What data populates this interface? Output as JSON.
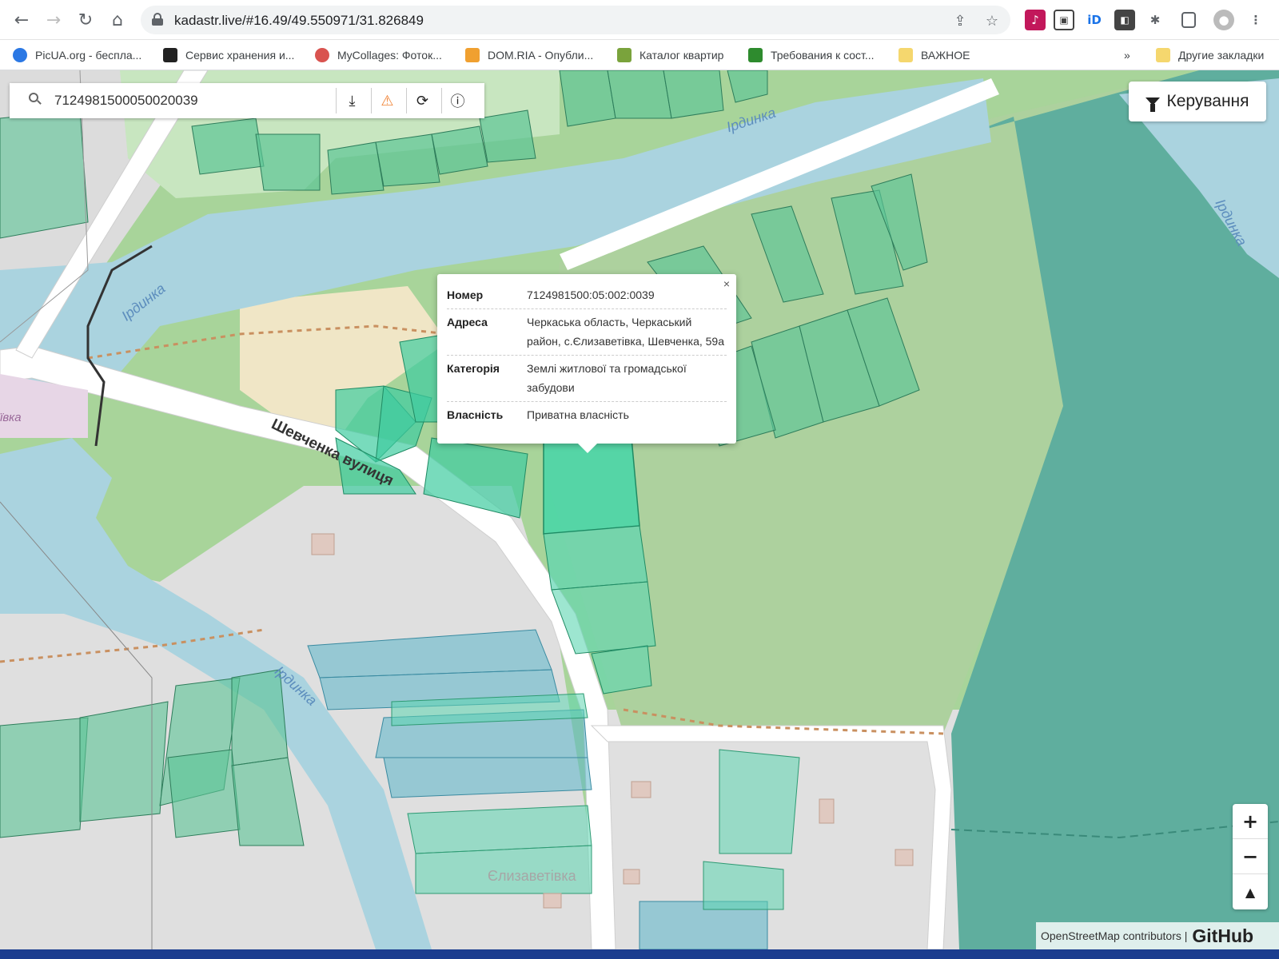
{
  "browser": {
    "url": "kadastr.live/#16.49/49.550971/31.826849",
    "bookmarks": [
      {
        "label": "PicUA.org - беспла...",
        "color": "#2b78e4"
      },
      {
        "label": "Сервис хранения и...",
        "color": "#222222"
      },
      {
        "label": "MyCollages: Фоток...",
        "color": "#d9534f"
      },
      {
        "label": "DOM.RIA - Опубли...",
        "color": "#f0a030"
      },
      {
        "label": "Каталог квартир",
        "color": "#7aa33c"
      },
      {
        "label": "Требования к сост...",
        "color": "#2e8b2e"
      },
      {
        "label": "ВАЖНОЕ",
        "color": "#f5d76e"
      }
    ],
    "overflow": "»",
    "other_bookmarks": "Другие закладки"
  },
  "search": {
    "value": "7124981500050020039"
  },
  "controls": {
    "label": "Керування"
  },
  "popup": {
    "close": "×",
    "rows": [
      {
        "key": "Номер",
        "value": "7124981500:05:002:0039"
      },
      {
        "key": "Адреса",
        "value": "Черкаська область, Черкаський район, с.Єлизаветівка, Шевченка, 59а"
      },
      {
        "key": "Категорія",
        "value": "Землі житлової та громадської забудови"
      },
      {
        "key": "Власність",
        "value": "Приватна власність"
      }
    ]
  },
  "map": {
    "river_labels": [
      "Ірдинка",
      "Ірдинка",
      "Ірдинка",
      "Ірдинка"
    ],
    "street_label": "Шевченка вулиця",
    "village_label": "Єлизаветівка",
    "partial_label": "ївка"
  },
  "zoom": {
    "in": "+",
    "out": "−",
    "north": "▲"
  },
  "attribution": {
    "osm": "OpenStreetMap contributors |",
    "github": "GitHub"
  }
}
